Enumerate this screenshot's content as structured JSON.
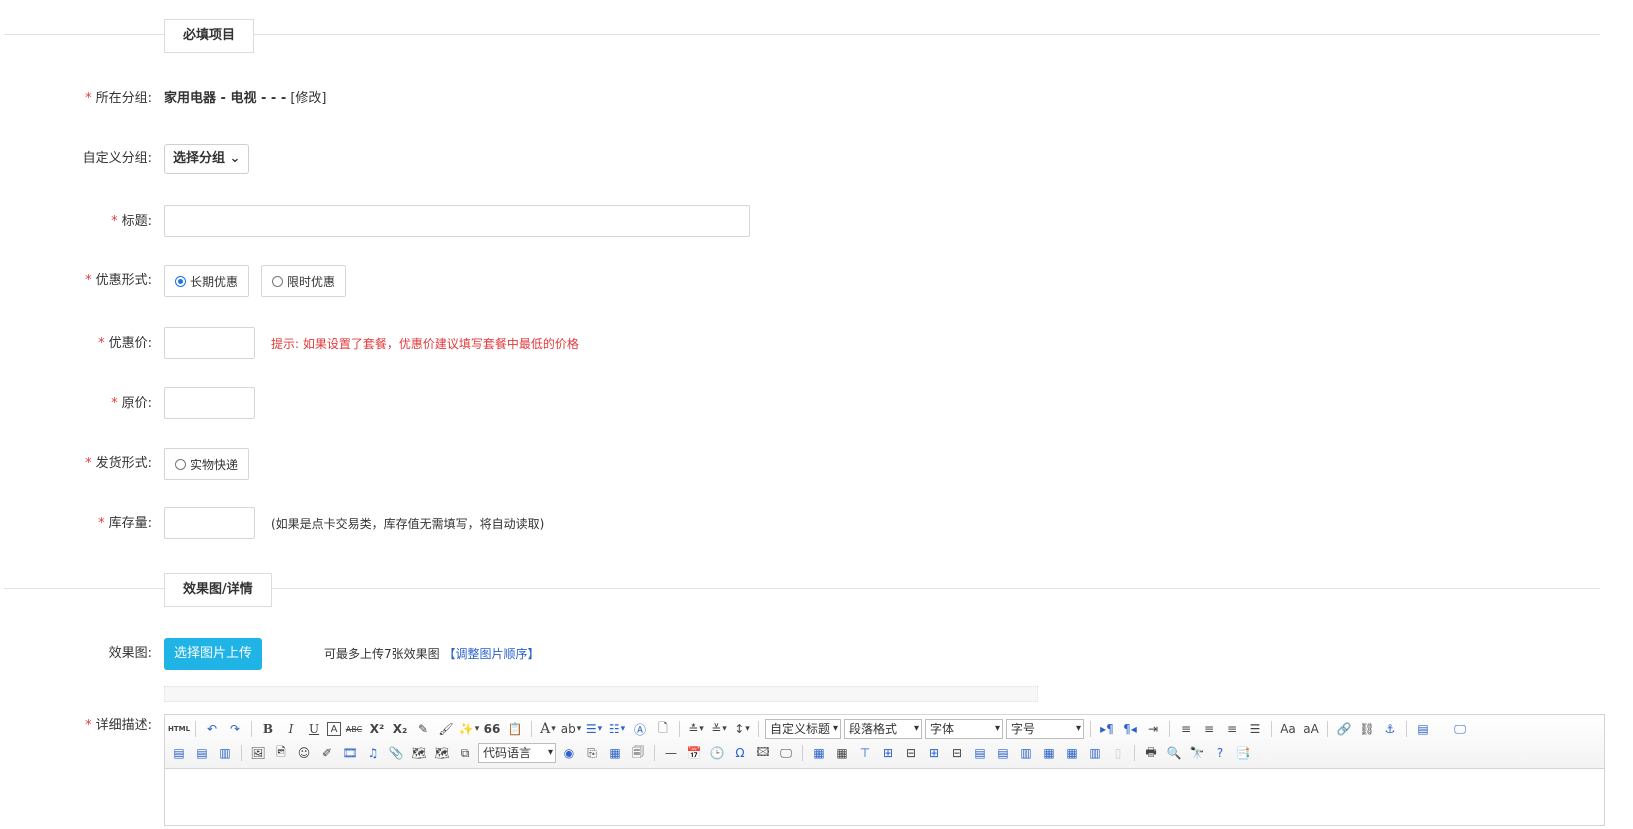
{
  "sections": {
    "required": "必填项目",
    "images": "效果图/详情"
  },
  "group": {
    "label": "所在分组:",
    "value": "家用电器 - 电视 - - -",
    "modify": "[修改]"
  },
  "custom_group": {
    "label": "自定义分组:",
    "select": "选择分组"
  },
  "title": {
    "label": "标题:"
  },
  "promo_type": {
    "label": "优惠形式:",
    "options": [
      "长期优惠",
      "限时优惠"
    ],
    "selected": "长期优惠"
  },
  "promo_price": {
    "label": "优惠价:",
    "hint": "提示: 如果设置了套餐，优惠价建议填写套餐中最低的价格"
  },
  "original_price": {
    "label": "原价:"
  },
  "shipping": {
    "label": "发货形式:",
    "option": "实物快递"
  },
  "stock": {
    "label": "库存量:",
    "hint": "(如果是点卡交易类，库存值无需填写，将自动读取)"
  },
  "effect": {
    "label": "效果图:",
    "upload_button": "选择图片上传",
    "tip": "可最多上传7张效果图",
    "adjust_link": "【调整图片顺序】"
  },
  "detail": {
    "label": "详细描述:"
  },
  "editor": {
    "selects": [
      "自定义标题",
      "段落格式",
      "字体",
      "字号",
      "代码语言"
    ],
    "buttons": [
      "HTML",
      "B",
      "I",
      "U",
      "A",
      "ABC",
      "X²",
      "X₂",
      "66"
    ]
  },
  "required_mark": "*",
  "colors": {
    "required": "#e4393c",
    "accent": "#1fb3e6",
    "link": "#2a62c9"
  }
}
